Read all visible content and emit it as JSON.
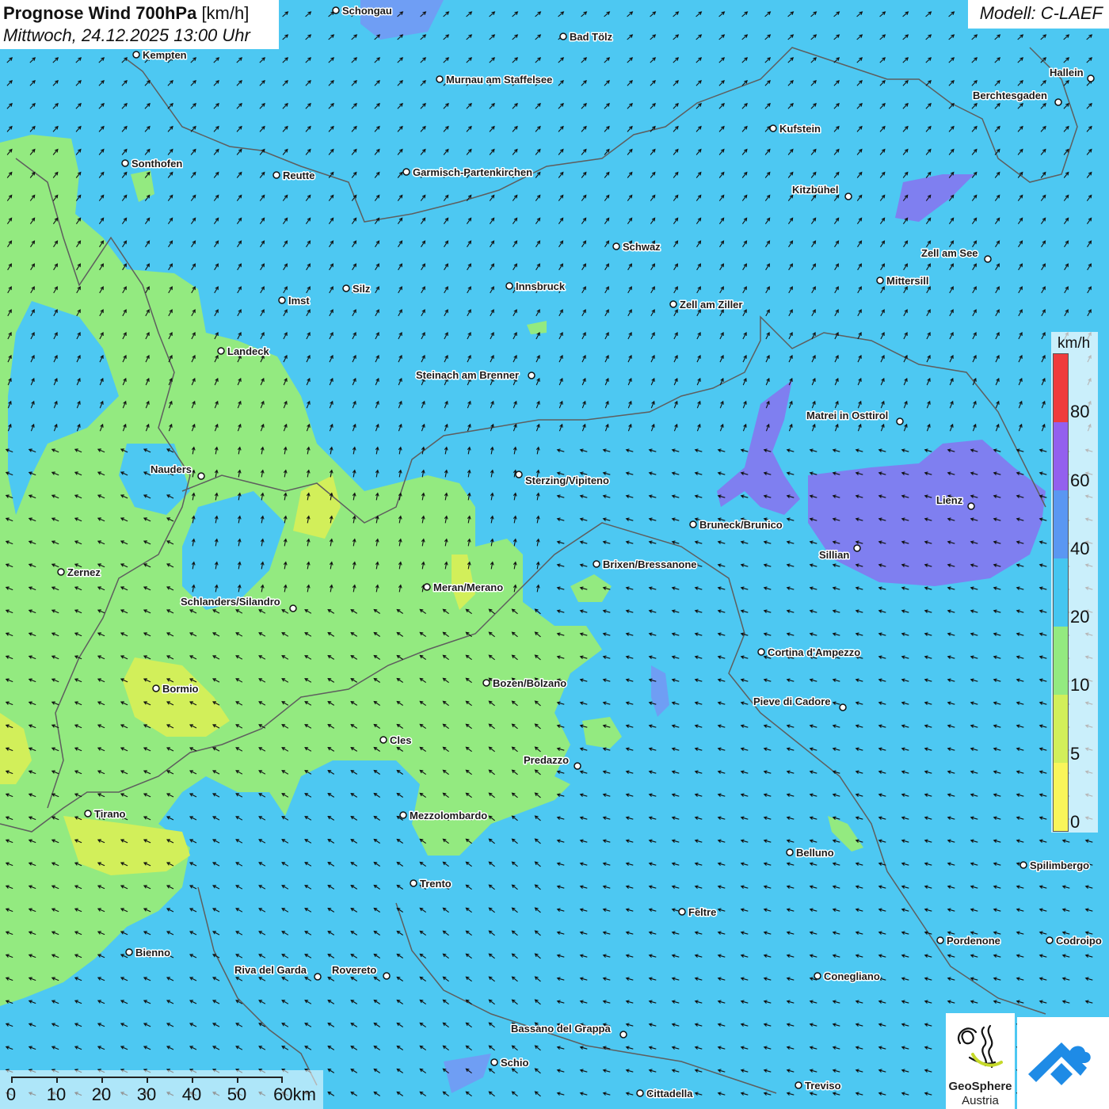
{
  "header": {
    "title": "Prognose Wind 700hPa",
    "unit": "[km/h]",
    "datetime": "Mittwoch, 24.12.2025 13:00 Uhr",
    "model": "Modell: C-LAEF"
  },
  "legend": {
    "unit": "km/h",
    "labels": [
      "0",
      "5",
      "10",
      "20",
      "40",
      "60",
      "80"
    ],
    "colors": [
      "#f9f55a",
      "#d2ef5a",
      "#93ea80",
      "#45c6f0",
      "#5a97f2",
      "#9360ee",
      "#ef3c3c"
    ]
  },
  "colors": {
    "background_speed": "#4dc8f2",
    "low_speed_green": "#93ea80",
    "very_low_yellow": "#d2ef5a",
    "elevated_purple": "#7f7ff0",
    "border_line": "#5e5e5e",
    "arrow": "#111111"
  },
  "scalebar": {
    "labels": [
      "0",
      "10",
      "20",
      "30",
      "40",
      "50",
      "60km"
    ]
  },
  "logo": {
    "brand_line1": "GeoSphere",
    "brand_line2": "Austria"
  },
  "cities": [
    {
      "name": "Schongau"
    },
    {
      "name": "Bad Tölz"
    },
    {
      "name": "Kempten"
    },
    {
      "name": "Murnau am Staffelsee"
    },
    {
      "name": "Hallein"
    },
    {
      "name": "Berchtesgaden"
    },
    {
      "name": "Kufstein"
    },
    {
      "name": "Sonthofen"
    },
    {
      "name": "Reutte"
    },
    {
      "name": "Garmisch-Partenkirchen"
    },
    {
      "name": "Kitzbühel"
    },
    {
      "name": "Schwaz"
    },
    {
      "name": "Zell am See"
    },
    {
      "name": "Mittersill"
    },
    {
      "name": "Silz"
    },
    {
      "name": "Innsbruck"
    },
    {
      "name": "Imst"
    },
    {
      "name": "Zell am Ziller"
    },
    {
      "name": "Landeck"
    },
    {
      "name": "Steinach am Brenner"
    },
    {
      "name": "Matrei in Osttirol"
    },
    {
      "name": "Nauders"
    },
    {
      "name": "Sterzing/Vipiteno"
    },
    {
      "name": "Lienz"
    },
    {
      "name": "Bruneck/Brunico"
    },
    {
      "name": "Sillian"
    },
    {
      "name": "Zernez"
    },
    {
      "name": "Brixen/Bressanone"
    },
    {
      "name": "Meran/Merano"
    },
    {
      "name": "Schlanders/Silandro"
    },
    {
      "name": "Cortina d'Ampezzo"
    },
    {
      "name": "Bormio"
    },
    {
      "name": "Bozen/Bolzano"
    },
    {
      "name": "Pieve di Cadore"
    },
    {
      "name": "Cles"
    },
    {
      "name": "Predazzo"
    },
    {
      "name": "Tirano"
    },
    {
      "name": "Mezzolombardo"
    },
    {
      "name": "Belluno"
    },
    {
      "name": "Spilimbergo"
    },
    {
      "name": "Trento"
    },
    {
      "name": "Feltre"
    },
    {
      "name": "Pordenone"
    },
    {
      "name": "Codroipo"
    },
    {
      "name": "Bienno"
    },
    {
      "name": "Riva del Garda"
    },
    {
      "name": "Rovereto"
    },
    {
      "name": "Conegliano"
    },
    {
      "name": "Bassano del Grappa"
    },
    {
      "name": "Schio"
    },
    {
      "name": "Treviso"
    },
    {
      "name": "Cittadella"
    }
  ]
}
